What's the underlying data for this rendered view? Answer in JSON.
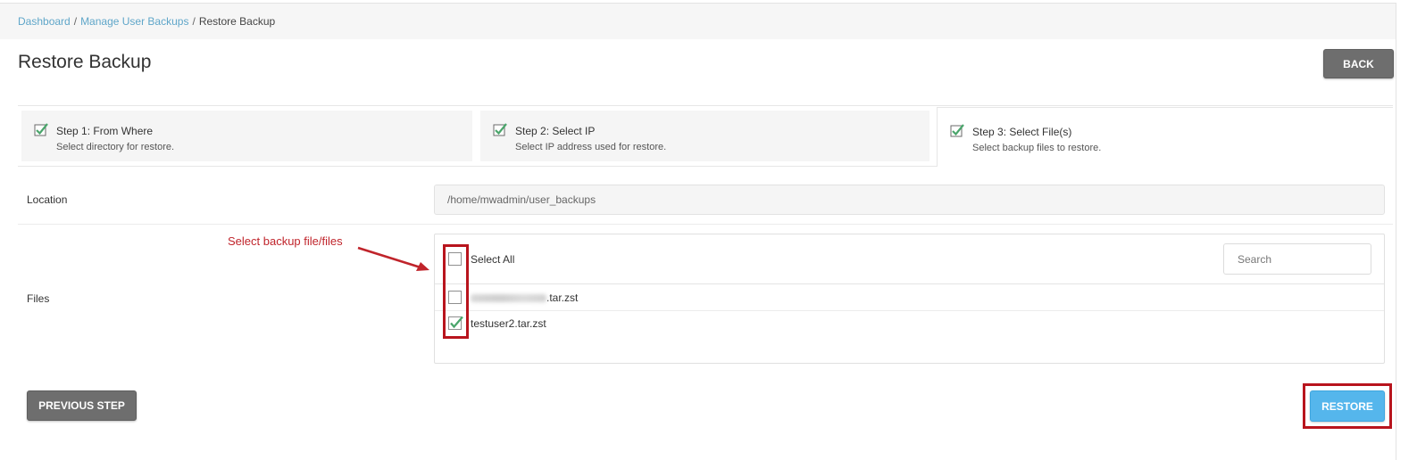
{
  "breadcrumb": {
    "items": [
      "Dashboard",
      "Manage User Backups",
      "Restore Backup"
    ],
    "separator": "/"
  },
  "page": {
    "title": "Restore Backup",
    "back_label": "BACK"
  },
  "steps": [
    {
      "title": "Step 1: From Where",
      "subtitle": "Select directory for restore.",
      "done": true
    },
    {
      "title": "Step 2: Select IP",
      "subtitle": "Select IP address used for restore.",
      "done": true
    },
    {
      "title": "Step 3: Select File(s)",
      "subtitle": "Select backup files to restore.",
      "done": true,
      "active": true
    }
  ],
  "location": {
    "label": "Location",
    "value": "/home/mwadmin/user_backups"
  },
  "files": {
    "label": "Files",
    "select_all_label": "Select All",
    "search_placeholder": "Search",
    "items": [
      {
        "name_suffix": ".tar.zst",
        "name_redacted": true,
        "checked": false
      },
      {
        "name": "testuser2.tar.zst",
        "checked": true
      }
    ]
  },
  "annotation": {
    "text": "Select backup file/files",
    "color": "#c0242b"
  },
  "actions": {
    "previous_label": "PREVIOUS STEP",
    "restore_label": "RESTORE"
  },
  "colors": {
    "link": "#5fa6c9",
    "check_green": "#4aa56b",
    "primary_blue": "#55b6ec",
    "dark_button": "#6e6e6e"
  }
}
